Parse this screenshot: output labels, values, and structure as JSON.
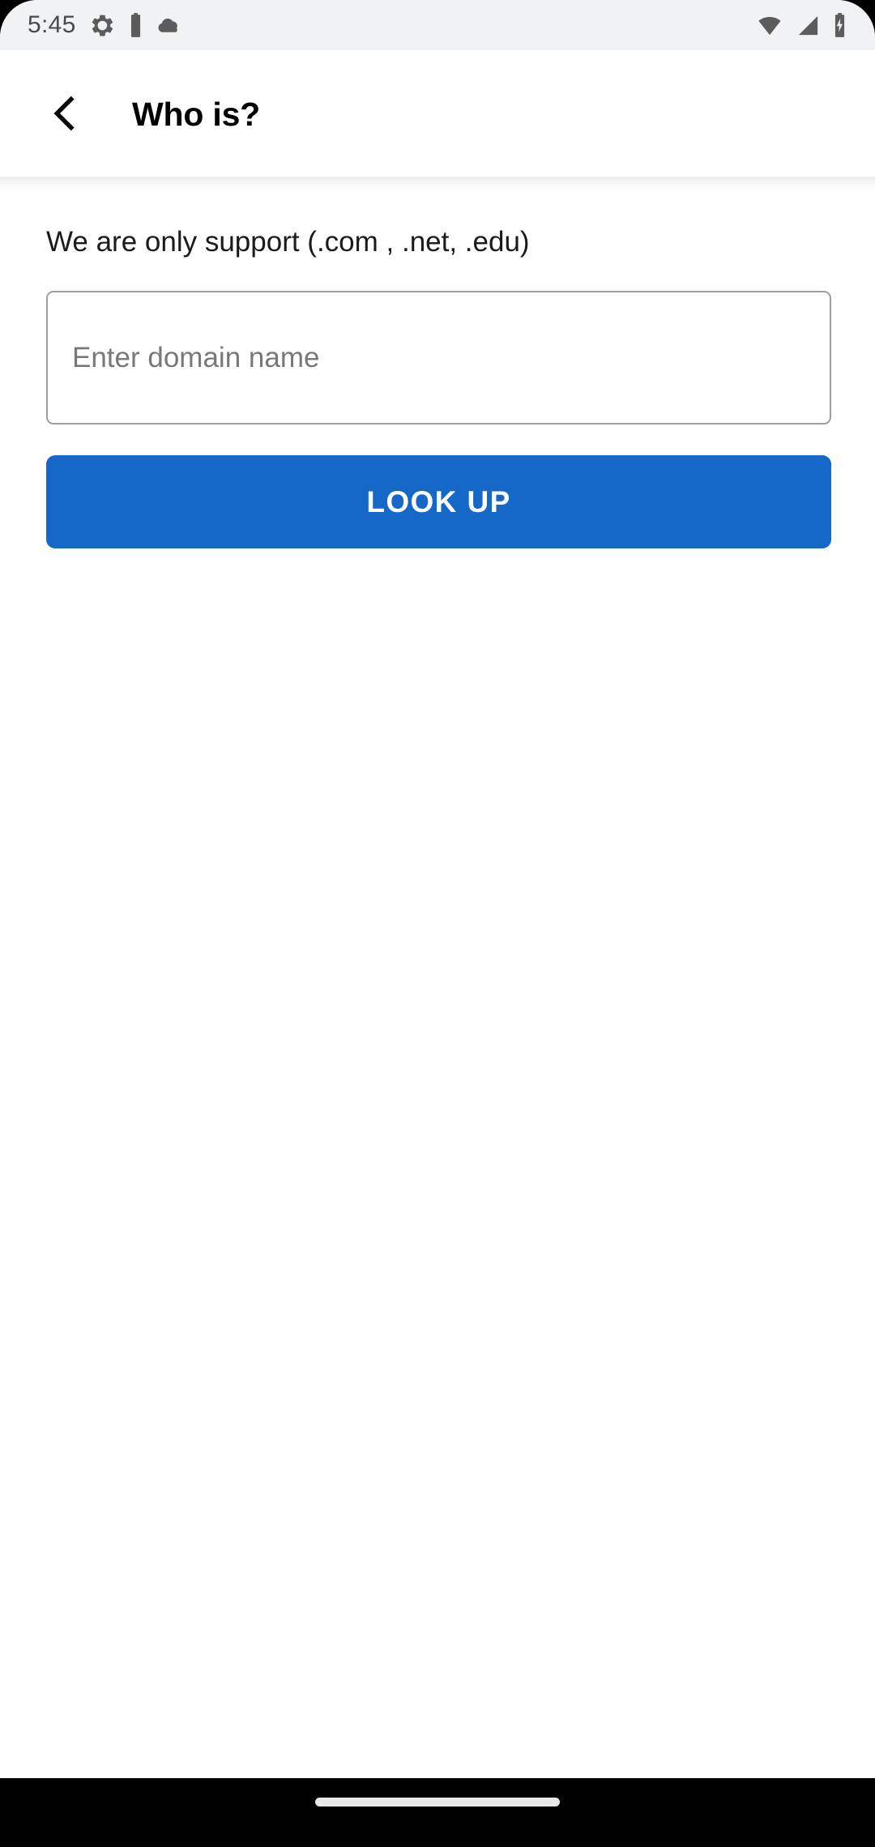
{
  "status_bar": {
    "time": "5:45",
    "left_icons": [
      "gear-icon",
      "battery-vertical-icon",
      "cloud-icon"
    ],
    "right_icons": [
      "wifi-icon",
      "cellular-signal-icon",
      "battery-charging-icon"
    ],
    "background_color": "#F1F2F4",
    "icon_color": "#5C5C5C"
  },
  "app_bar": {
    "back_icon": "chevron-left-icon",
    "title": "Who is?",
    "background_color": "#FFFFFF",
    "title_color": "#000000"
  },
  "main": {
    "support_note": "We are only support (.com , .net, .edu)",
    "domain_field": {
      "value": "",
      "placeholder": "Enter domain name",
      "border_color": "#9E9E9E",
      "placeholder_color": "#787878"
    },
    "lookup_button": {
      "label": "LOOK UP",
      "background_color": "#1668C8",
      "text_color": "#FFFFFF"
    }
  },
  "navigation_bar": {
    "home_indicator": "home-pill-indicator",
    "background_color": "#000000",
    "pill_color": "#E8E8E8"
  }
}
